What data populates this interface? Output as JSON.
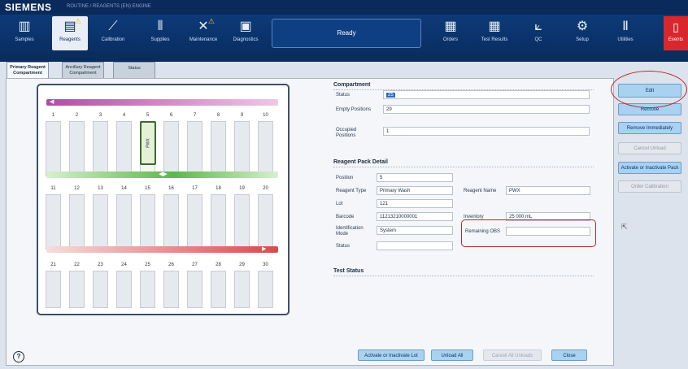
{
  "brand": {
    "logo": "SIEMENS",
    "sub": "ROUTINE / REAGENTS (EN) ENGINE"
  },
  "toolbar": {
    "items": [
      {
        "label": "Samples",
        "icon": "samples-icon",
        "glyph": "▥"
      },
      {
        "label": "Reagents",
        "icon": "reagents-icon",
        "glyph": "▤",
        "warning": "⚠",
        "active": true
      },
      {
        "label": "Calibration",
        "icon": "calibration-icon",
        "glyph": "⟋"
      },
      {
        "label": "Supplies",
        "icon": "supplies-icon",
        "glyph": "⫴"
      },
      {
        "label": "Maintenance",
        "icon": "maintenance-icon",
        "glyph": "✕",
        "warning": "⚠"
      },
      {
        "label": "Diagnostics",
        "icon": "diagnostics-icon",
        "glyph": "▣"
      },
      {
        "label": "Orders",
        "icon": "orders-icon",
        "glyph": "▦"
      },
      {
        "label": "Test Results",
        "icon": "test-results-icon",
        "glyph": "▦"
      },
      {
        "label": "QC",
        "icon": "qc-icon",
        "glyph": "⟀"
      },
      {
        "label": "Setup",
        "icon": "setup-icon",
        "glyph": "⚙"
      },
      {
        "label": "Utilities",
        "icon": "utilities-icon",
        "glyph": "Ⅱ"
      }
    ],
    "status": "Ready",
    "events": {
      "label": "Events",
      "glyph": "▯"
    }
  },
  "tabs": [
    {
      "label": "Primary Reagent Compartment",
      "active": true
    },
    {
      "label": "Ancillary Reagent Compartment",
      "active": false
    },
    {
      "label": "Status",
      "active": false
    }
  ],
  "rack": {
    "rows": [
      {
        "numbers": [
          "1",
          "2",
          "3",
          "4",
          "5",
          "6",
          "7",
          "8",
          "9",
          "10"
        ]
      },
      {
        "numbers": [
          "11",
          "12",
          "13",
          "14",
          "15",
          "16",
          "17",
          "18",
          "19",
          "20"
        ]
      },
      {
        "numbers": [
          "21",
          "22",
          "23",
          "24",
          "25",
          "26",
          "27",
          "28",
          "29",
          "30"
        ]
      }
    ],
    "pack_label": "PWX"
  },
  "compartment": {
    "title": "Compartment",
    "status_label": "Status",
    "status_value": "25",
    "empty_label": "Empty Positions",
    "empty_value": "29",
    "occupied_label": "Occupied Positions",
    "occupied_value": "1"
  },
  "pack_detail": {
    "title": "Reagent Pack Detail",
    "position_label": "Position",
    "position_value": "5",
    "type_label": "Reagent Type",
    "type_value": "Primary Wash",
    "name_label": "Reagent Name",
    "name_value": "PWX",
    "lot_label": "Lot",
    "lot_value": "121",
    "barcode_label": "Barcode",
    "barcode_value": "11213210000001",
    "inventory_label": "Inventory",
    "inventory_value": "25 000 mL",
    "id_mode_label": "Identification Mode",
    "id_mode_value": "System",
    "remaining_label": "Remaining OBS",
    "status_label": "Status"
  },
  "test_status": {
    "title": "Test Status"
  },
  "right_buttons": [
    {
      "label": "Edit",
      "enabled": true
    },
    {
      "label": "Remove",
      "enabled": true
    },
    {
      "label": "Remove Immediately",
      "enabled": true
    },
    {
      "label": "Cancel Unload",
      "enabled": false
    },
    {
      "label": "Activate or Inactivate Pack",
      "enabled": true
    },
    {
      "label": "Order Calibration",
      "enabled": false
    }
  ],
  "bottom_buttons": [
    {
      "label": "Activate or Inactivate Lot",
      "enabled": true
    },
    {
      "label": "Unload All",
      "enabled": true
    },
    {
      "label": "Cancel All Unloads",
      "enabled": false
    },
    {
      "label": "Close",
      "enabled": true
    }
  ],
  "help": "?",
  "colors": {
    "navy": "#0a2f63",
    "accent_button": "#a8d2f0",
    "alert_red": "#d8282d",
    "annotation": "#b52a2a"
  }
}
